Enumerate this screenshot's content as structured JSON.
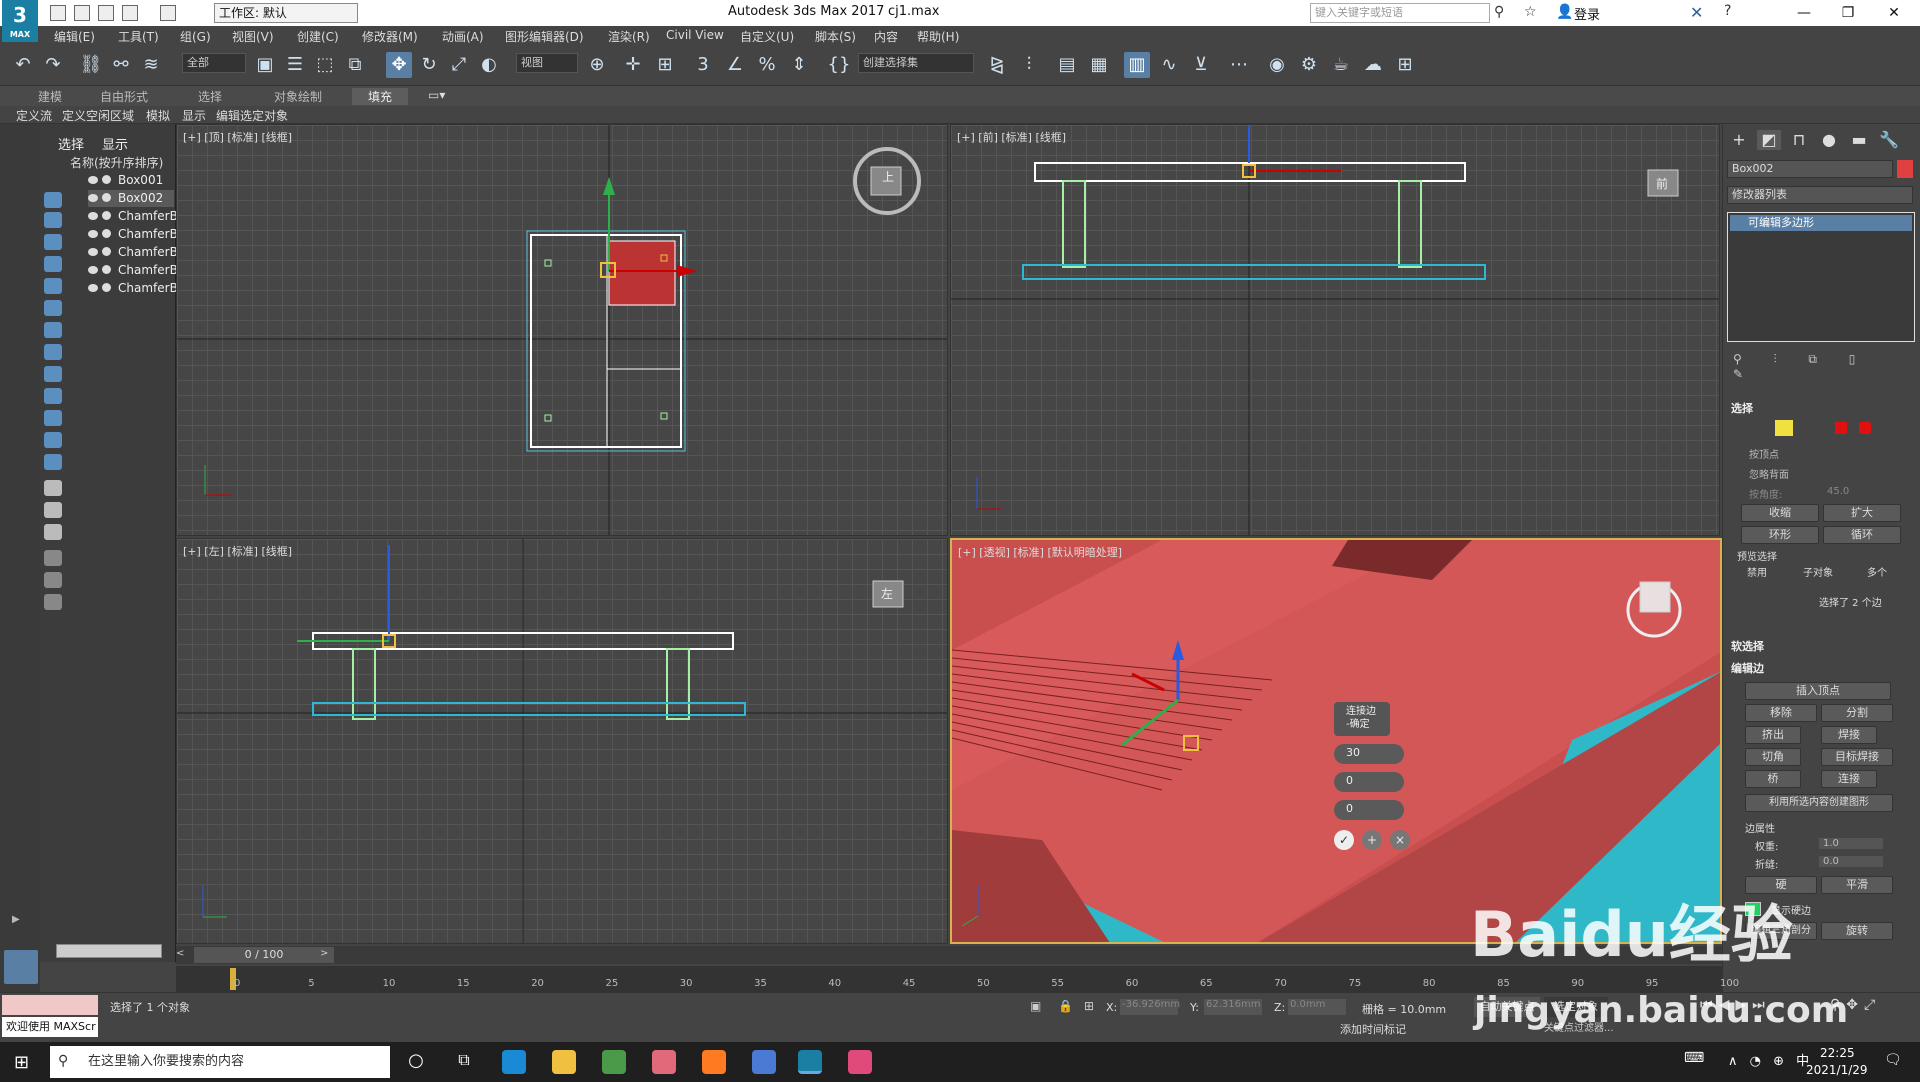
{
  "app": {
    "logo": "3",
    "logo_sub": "MAX",
    "workspace": "工作区: 默认",
    "title": "Autodesk 3ds Max 2017",
    "file": "cj1.max",
    "search_placeholder": "键入关键字或短语",
    "login": "登录"
  },
  "menu": [
    "编辑(E)",
    "工具(T)",
    "组(G)",
    "视图(V)",
    "创建(C)",
    "修改器(M)",
    "动画(A)",
    "图形编辑器(D)",
    "渲染(R)",
    "Civil View",
    "自定义(U)",
    "脚本(S)",
    "内容",
    "帮助(H)"
  ],
  "toolbar": {
    "filter": "全部",
    "coord": "视图",
    "selection_set": "创建选择集"
  },
  "ribbon": {
    "tabs": [
      "建模",
      "自由形式",
      "选择",
      "对象绘制",
      "填充"
    ],
    "selected": "填充",
    "sub": [
      "定义流",
      "定义空闲区域",
      "模拟",
      "显示",
      "编辑选定对象"
    ]
  },
  "explorer": {
    "tabs": [
      "选择",
      "显示"
    ],
    "header": "名称(按升序排序)",
    "rows": [
      "Box001",
      "Box002",
      "ChamferB",
      "ChamferB",
      "ChamferB",
      "ChamferB",
      "ChamferB"
    ],
    "selected_index": 1
  },
  "viewports": {
    "top": "[+] [顶] [标准] [线框]",
    "front": "[+] [前] [标准] [线框]",
    "left": "[+] [左] [标准] [线框]",
    "persp": "[+] [透视] [标准] [默认明暗处理]",
    "cube_front": "前",
    "cube_left": "左",
    "cube_top": "上"
  },
  "float_menu": {
    "title_line1": "连接边",
    "title_line2": "-确定",
    "segments": "30",
    "pinch": "0",
    "slide": "0"
  },
  "command_panel": {
    "object_name": "Box002",
    "object_color": "#e04040",
    "modifier_list": "修改器列表",
    "stack_item": "可编辑多边形",
    "selection_title": "选择",
    "by_vertex": "按顶点",
    "ignore_back": "忽略背面",
    "angle_label": "按角度:",
    "angle_value": "45.0",
    "shrink": "收缩",
    "grow": "扩大",
    "ring": "环形",
    "loop": "循环",
    "preview_title": "预览选择",
    "preview_disable": "禁用",
    "preview_sub": "子对象",
    "preview_multi": "多个",
    "selected_count": "选择了 2 个边",
    "soft_selection": "软选择",
    "edit_edges": "编辑边",
    "insert_vertex": "插入顶点",
    "remove": "移除",
    "split": "分割",
    "extrude": "挤出",
    "weld": "焊接",
    "chamfer": "切角",
    "target_weld": "目标焊接",
    "bridge": "桥",
    "connect": "连接",
    "create_shape": "利用所选内容创建图形",
    "edge_props": "边属性",
    "weight_label": "权重:",
    "weight_value": "1.0",
    "crease_label": "折缝:",
    "crease_value": "0.0",
    "hard": "硬",
    "smooth": "平滑",
    "show_hard": "显示硬边",
    "edit_tri": "编辑三角剖分",
    "turn": "旋转"
  },
  "timeline": {
    "frame": "0 / 100",
    "ticks": [
      "0",
      "5",
      "10",
      "15",
      "20",
      "25",
      "30",
      "35",
      "40",
      "45",
      "50",
      "55",
      "60",
      "65",
      "70",
      "75",
      "80",
      "85",
      "90",
      "95",
      "100"
    ]
  },
  "status": {
    "welcome": "欢迎使用 MAXScr",
    "message": "选择了 1 个对象",
    "x_label": "X:",
    "x": "-36.926mm",
    "y_label": "Y:",
    "y": "62.316mm",
    "z_label": "Z:",
    "z": "0.0mm",
    "grid": "栅格 = 10.0mm",
    "add_tag": "添加时间标记",
    "auto_key": "自动关键点",
    "sel_obj": "选定对象",
    "set_key": "关键点过滤器..."
  },
  "taskbar": {
    "search": "在这里输入你要搜索的内容",
    "time": "22:25",
    "date": "2021/1/29"
  },
  "watermark": {
    "line1": "Baidu经验",
    "line2": "jingyan.baidu.com"
  },
  "colors": {
    "accent": "#5a7fa5",
    "selection_red": "#d04a4a",
    "teal": "#3ab8c8",
    "wire_white": "#ffffff",
    "wire_green": "#a6f0a6",
    "wire_cyan": "#2fb8d6"
  }
}
